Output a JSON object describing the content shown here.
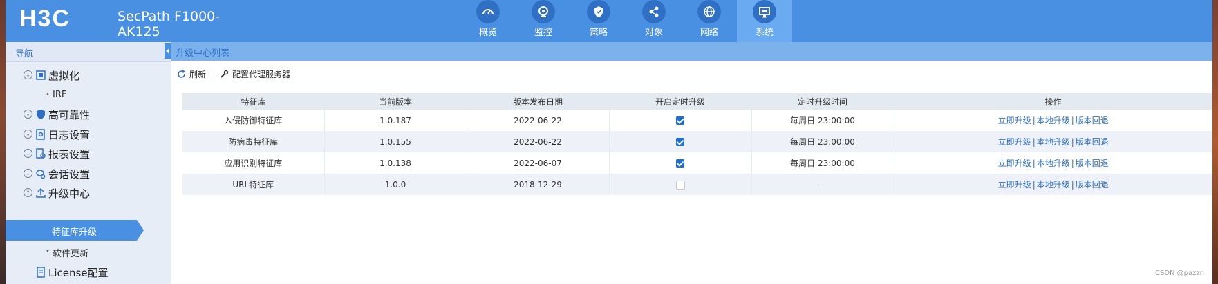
{
  "header": {
    "brand": "H3C",
    "product_line1": "SecPath F1000-",
    "product_line2": "AK125",
    "nav": [
      {
        "label": "概览",
        "icon": "dashboard-icon"
      },
      {
        "label": "监控",
        "icon": "camera-icon"
      },
      {
        "label": "策略",
        "icon": "shield-icon"
      },
      {
        "label": "对象",
        "icon": "share-icon"
      },
      {
        "label": "网络",
        "icon": "globe-icon"
      },
      {
        "label": "系统",
        "icon": "monitor-icon",
        "active": true
      }
    ]
  },
  "sidebar": {
    "title": "导航",
    "items": [
      {
        "label": "虚拟化",
        "type": "group"
      },
      {
        "label": "IRF",
        "type": "sub"
      },
      {
        "label": "高可靠性",
        "type": "group"
      },
      {
        "label": "日志设置",
        "type": "group"
      },
      {
        "label": "报表设置",
        "type": "group"
      },
      {
        "label": "会话设置",
        "type": "group"
      },
      {
        "label": "升级中心",
        "type": "group"
      },
      {
        "label": "特征库升级",
        "type": "active"
      },
      {
        "label": "软件更新",
        "type": "sub"
      },
      {
        "label": "License配置",
        "type": "group"
      }
    ]
  },
  "main": {
    "title": "升级中心列表",
    "toolbar": {
      "refresh": "刷新",
      "proxy": "配置代理服务器"
    },
    "table": {
      "headers": [
        "特征库",
        "当前版本",
        "版本发布日期",
        "开启定时升级",
        "定时升级时间",
        "操作"
      ],
      "rows": [
        {
          "name": "入侵防御特征库",
          "version": "1.0.187",
          "date": "2022-06-22",
          "scheduled": true,
          "time": "每周日 23:00:00"
        },
        {
          "name": "防病毒特征库",
          "version": "1.0.155",
          "date": "2022-06-22",
          "scheduled": true,
          "time": "每周日 23:00:00"
        },
        {
          "name": "应用识别特征库",
          "version": "1.0.138",
          "date": "2022-06-07",
          "scheduled": true,
          "time": "每周日 23:00:00"
        },
        {
          "name": "URL特征库",
          "version": "1.0.0",
          "date": "2018-12-29",
          "scheduled": false,
          "time": "-"
        }
      ],
      "actions": {
        "upgrade_now": "立即升级",
        "local_upgrade": "本地升级",
        "rollback": "版本回退",
        "separator": "|"
      }
    }
  },
  "watermark": "CSDN @pazzn",
  "colors": {
    "header": "#4a90e2",
    "nav_active": "#6aaaf0",
    "link": "#2f6fc4",
    "checkbox": "#1e6fd0"
  }
}
